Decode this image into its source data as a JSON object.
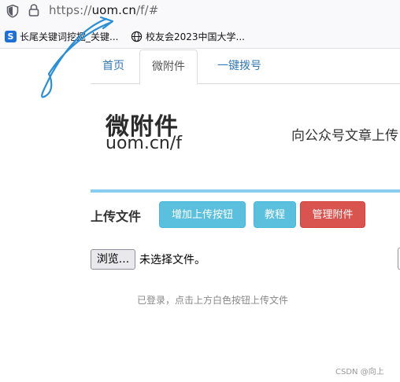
{
  "browser": {
    "url_prefix": "https://",
    "url_domain": "uom.cn",
    "url_path": "/f/#",
    "bookmarks": [
      {
        "label": "长尾关键词挖掘_关键...",
        "icon": "s-logo-icon",
        "icon_glyph": "S"
      },
      {
        "label": "校友会2023中国大学...",
        "icon": "globe-icon"
      }
    ]
  },
  "nav": {
    "tabs": [
      {
        "label": "首页",
        "active": false
      },
      {
        "label": "微附件",
        "active": true
      },
      {
        "label": "一键拨号",
        "active": false
      }
    ]
  },
  "brand": {
    "title": "微附件",
    "subtitle": "uom.cn/f",
    "tagline": "向公众号文章上传"
  },
  "upload": {
    "heading": "上传文件",
    "add_button": "增加上传按钮",
    "tutorial_button": "教程",
    "manage_button": "管理附件",
    "browse_button": "浏览...",
    "file_status": "未选择文件。",
    "hint": "已登录，点击上方白色按钮上传文件"
  },
  "watermark": "CSDN @向上",
  "colors": {
    "link": "#337ab7",
    "info": "#5bc0de",
    "danger": "#d9534f",
    "divider": "#87cef0",
    "scribble": "#2a8fd6"
  }
}
